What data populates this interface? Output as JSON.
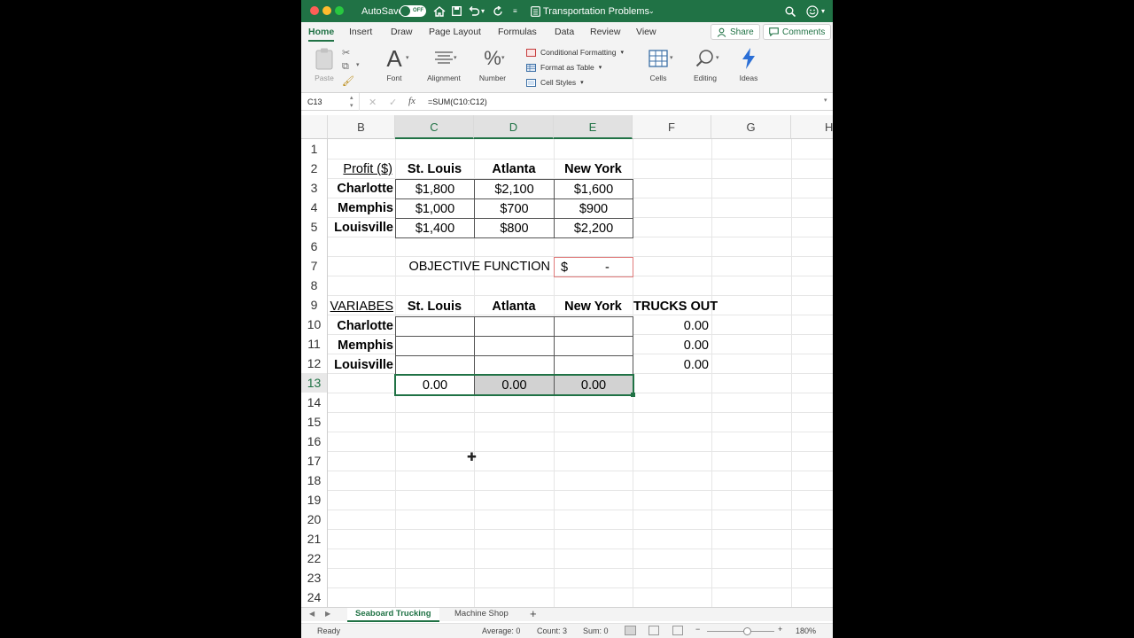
{
  "titlebar": {
    "autosave_label": "AutoSave",
    "autosave_state": "OFF",
    "title": "Transportation Problems",
    "accent": "#207245"
  },
  "ribbon": {
    "tabs": [
      "Home",
      "Insert",
      "Draw",
      "Page Layout",
      "Formulas",
      "Data",
      "Review",
      "View"
    ],
    "share_label": "Share",
    "comments_label": "Comments",
    "paste_label": "Paste",
    "font_label": "Font",
    "alignment_label": "Alignment",
    "number_label": "Number",
    "conditional_formatting_label": "Conditional Formatting",
    "format_as_table_label": "Format as Table",
    "cell_styles_label": "Cell Styles",
    "cells_label": "Cells",
    "editing_label": "Editing",
    "ideas_label": "Ideas"
  },
  "formula_bar": {
    "name_box": "C13",
    "fx": "fx",
    "formula": "=SUM(C10:C12)"
  },
  "grid": {
    "columns": [
      "B",
      "C",
      "D",
      "E",
      "F",
      "G",
      "H"
    ],
    "rows": [
      "1",
      "2",
      "3",
      "4",
      "5",
      "6",
      "7",
      "8",
      "9",
      "10",
      "11",
      "12",
      "13",
      "14",
      "15",
      "16",
      "17",
      "18",
      "19",
      "20",
      "21",
      "22",
      "23",
      "24"
    ],
    "profit_header": "Profit ($)",
    "destinations": [
      "St. Louis",
      "Atlanta",
      "New York"
    ],
    "origins": [
      "Charlotte",
      "Memphis",
      "Louisville"
    ],
    "profits": [
      [
        "$1,800",
        "$2,100",
        "$1,600"
      ],
      [
        "$1,000",
        "$700",
        "$900"
      ],
      [
        "$1,400",
        "$800",
        "$2,200"
      ]
    ],
    "objective_label": "OBJECTIVE FUNCTION",
    "objective_currency": "$",
    "objective_value": "-",
    "variables_header": "VARIABES",
    "trucks_out_header": "TRUCKS OUT",
    "trucks_out": [
      "0.00",
      "0.00",
      "0.00"
    ],
    "column_totals": [
      "0.00",
      "0.00",
      "0.00"
    ]
  },
  "sheet_tabs": [
    "Seaboard Trucking",
    "Machine Shop"
  ],
  "status": {
    "ready": "Ready",
    "average": "Average: 0",
    "count": "Count: 3",
    "sum": "Sum: 0",
    "zoom": "180%"
  }
}
